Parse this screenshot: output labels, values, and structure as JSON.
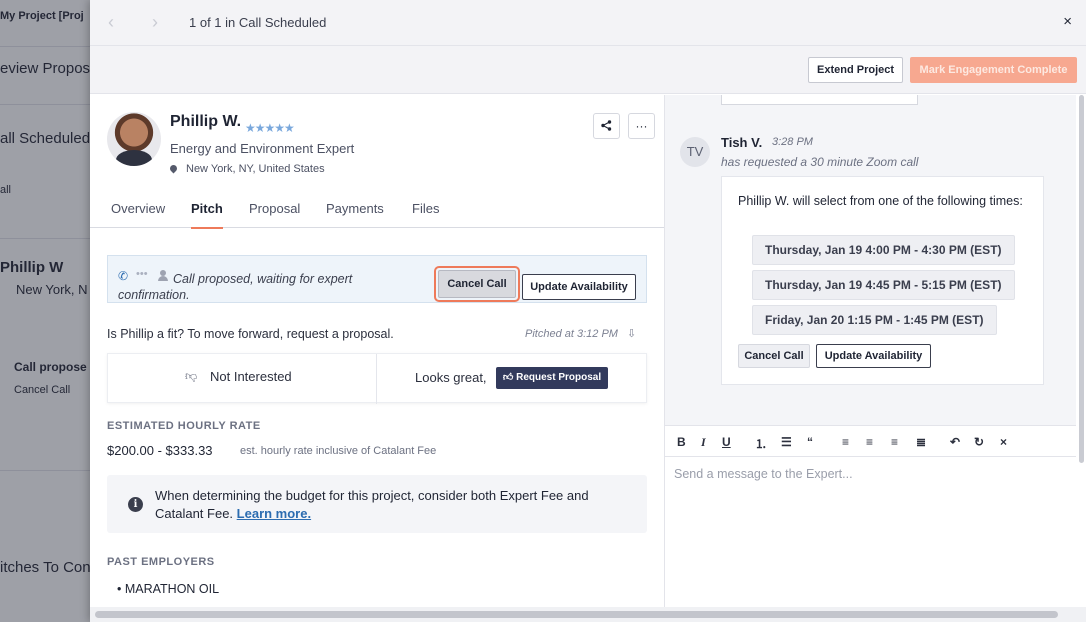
{
  "background": {
    "items": [
      "My Project [Proj",
      "eview Propos",
      "all Scheduled",
      "all",
      "Phillip W",
      "New York, N",
      "Call propose",
      "Cancel Call",
      "itches To Con"
    ]
  },
  "modal": {
    "counter": "1 of 1 in Call Scheduled",
    "close": "×",
    "extend_label": "Extend Project",
    "mark_label": "Mark Engagement Complete"
  },
  "expert": {
    "name": "Phillip W.",
    "stars": "★★★★★",
    "headline": "Energy and Environment Expert",
    "location": "New York, NY, United States"
  },
  "tabs": [
    "Overview",
    "Pitch",
    "Proposal",
    "Payments",
    "Files"
  ],
  "call": {
    "status_text": "Call proposed, waiting for expert confirmation.",
    "cancel_label": "Cancel Call",
    "update_label": "Update Availability"
  },
  "pitch": {
    "question": "Is Phillip a fit? To move forward, request a proposal.",
    "pitched_at": "Pitched at 3:12 PM",
    "not_interested": "Not Interested",
    "looks_great": "Looks great,",
    "request_proposal": "Request Proposal"
  },
  "rate": {
    "heading": "ESTIMATED HOURLY RATE",
    "value": "$200.00 - $333.33",
    "note": "est. hourly rate inclusive of Catalant Fee"
  },
  "info": {
    "text": "When determining the budget for this project, consider both Expert Fee and Catalant Fee.",
    "link": "Learn more."
  },
  "employers": {
    "heading": "PAST EMPLOYERS",
    "items": [
      "MARATHON OIL"
    ]
  },
  "chat": {
    "initials": "TV",
    "from": "Tish V.",
    "time": "3:28 PM",
    "request": "has requested a 30 minute Zoom call",
    "intro": "Phillip W. will select from one of the following times:",
    "slots": [
      "Thursday, Jan 19 4:00 PM - 4:30 PM (EST)",
      "Thursday, Jan 19 4:45 PM - 5:15 PM (EST)",
      "Friday, Jan 20 1:15 PM - 1:45 PM (EST)"
    ],
    "cancel_label": "Cancel Call",
    "update_label": "Update Availability"
  },
  "editor": {
    "placeholder": "Send a message to the Expert..."
  },
  "colors": {
    "accent": "#ee7a5a",
    "primary_dark": "#323a5c",
    "link": "#2c6cb0",
    "star": "#7aa8dc"
  }
}
